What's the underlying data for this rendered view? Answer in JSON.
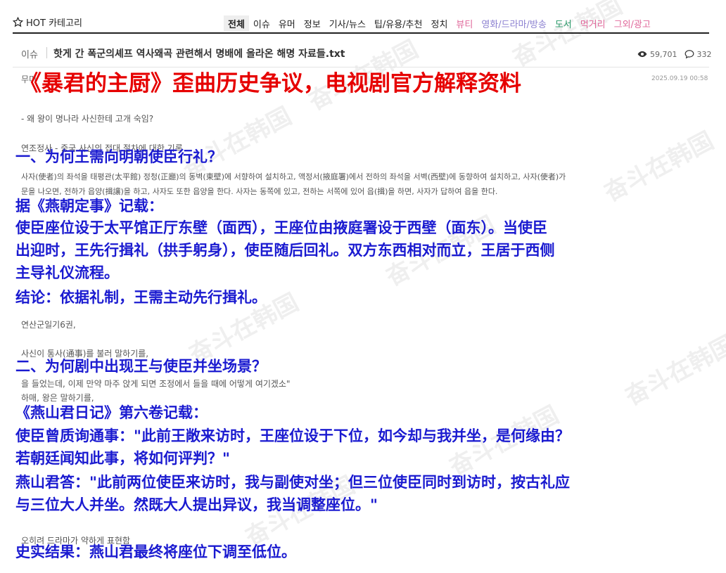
{
  "nav": {
    "brand": "HOT 카테고리",
    "tabs": [
      {
        "label": "전체",
        "color": "#222222",
        "active": true
      },
      {
        "label": "이슈",
        "color": "#222222"
      },
      {
        "label": "유머",
        "color": "#222222"
      },
      {
        "label": "정보",
        "color": "#222222"
      },
      {
        "label": "기사/뉴스",
        "color": "#222222"
      },
      {
        "label": "팁/유용/추천",
        "color": "#222222"
      },
      {
        "label": "정치",
        "color": "#222222"
      },
      {
        "label": "뷰티",
        "color": "#e0679a"
      },
      {
        "label": "영화/드라마/방송",
        "color": "#8a7fd0"
      },
      {
        "label": "도서",
        "color": "#2a9a6a"
      },
      {
        "label": "먹거리",
        "color": "#e0679a"
      },
      {
        "label": "그외/광고",
        "color": "#e0679a"
      }
    ]
  },
  "post": {
    "category": "이슈",
    "title": "핫게 간 폭군의셰프 역사왜곡 관련해서 명배에 올라온 해명 자료들.txt",
    "views": "59,701",
    "comments": "332",
    "author_partial": "무미",
    "date": "2025.09.19 00:58"
  },
  "background_text": {
    "l1": "- 왜 왕이 명나라 사신한테 고개 숙임?",
    "l2": "연조정사 - 중국 사신의 접대 절차에 대한 기록",
    "l3": "사자(使者)의 좌석을 태평관(太平館) 정청(正廳)의 동벽(東壁)에 서향하여 설치하고, 액정서(掖庭署)에서 전하의 좌석을 서벽(西壁)에 동향하여 설치하고, 사자(使者)가",
    "l4": "문을 나오면, 전하가 읍양(揖讓)을 하고, 사자도 또한 읍양을 한다. 사자는 동쪽에 있고, 전하는 서쪽에 있어 읍(揖)을 하면, 사자가 답하여 읍을 한다.",
    "l5": "연산군일기6권,",
    "l6": "사신이 통사(通事)를 불러 말하기를,",
    "l7": "을 들었는데, 이제 만약 마주 앉게 되면 조정에서 들을 때에 어떻게 여기겠소\"",
    "l8": "하매, 왕은 말하기를,",
    "l9": "오히려 드라마가 약하게 표현함"
  },
  "watermark": "奋斗在韩国",
  "overlay": {
    "title": "《暴君的主厨》歪曲历史争议，电视剧官方解释资料",
    "lines": [
      "一、为何王需向明朝使臣行礼？",
      "据《燕朝定事》记载：",
      "使臣座位设于太平馆正厅东壁（面西），王座位由掖庭署设于西壁（面东）。当使臣",
      "出迎时，王先行揖礼（拱手躬身），使臣随后回礼。双方东西相对而立，王居于西侧",
      "主导礼仪流程。",
      "结论：依据礼制，王需主动先行揖礼。",
      "二、为何剧中出现王与使臣并坐场景？",
      "《燕山君日记》第六卷记载：",
      "使臣曾质询通事：\"此前王敞来访时，王座位设于下位，如今却与我并坐，是何缘由？",
      "若朝廷闻知此事，将如何评判？\"",
      "燕山君答：\"此前两位使臣来访时，我与副使对坐；但三位使臣同时到访时，按古礼应",
      "与三位大人并坐。然既大人提出异议，我当调整座位。\"",
      "史实结果：燕山君最终将座位下调至低位。"
    ]
  },
  "colors": {
    "red": "#e60000",
    "blue": "#1a1ad0"
  }
}
